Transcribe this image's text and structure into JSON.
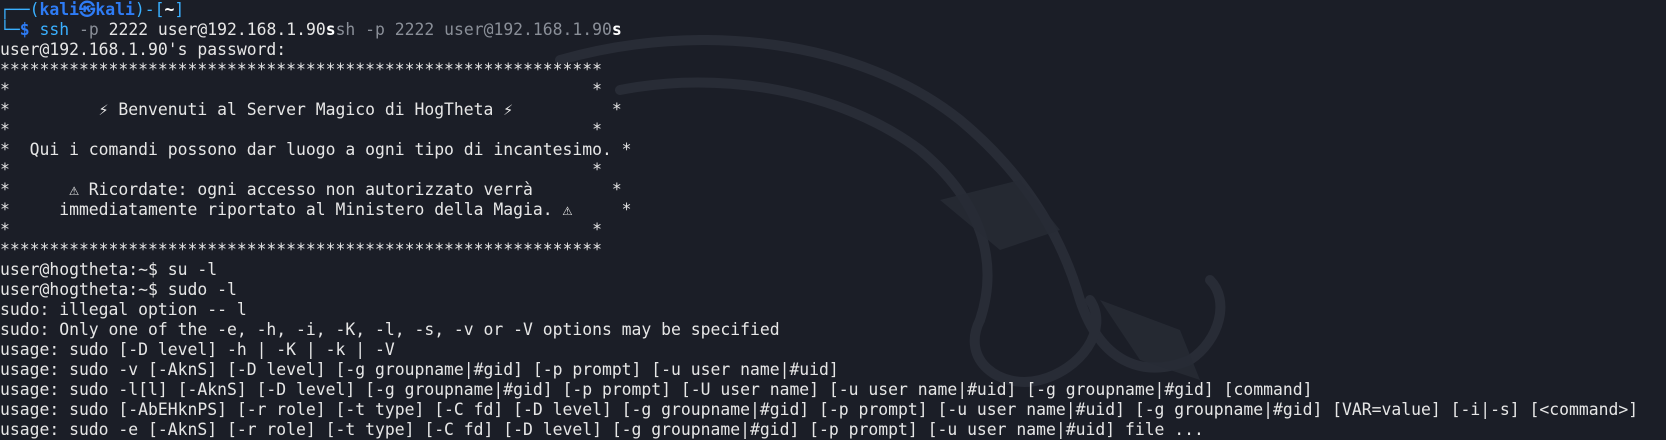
{
  "prompt": {
    "corner_top": "┌──(",
    "user": "kali",
    "at_symbol": "㉿",
    "host": "kali",
    "mid": ")-[",
    "dir": "~",
    "end": "]",
    "corner_bottom": "└─",
    "dollar": "$",
    "command": "ssh",
    "args_dim": " -p",
    "args_rest": " 2222 user@192.168.1.90",
    "cursor_char": "s",
    "autosuggest": "sh -p 2222 user@192.168.1.90",
    "autosuggest_end": "s"
  },
  "lines": [
    "user@192.168.1.90's password:",
    "*************************************************************",
    "*                                                           *",
    "*         ⚡ Benvenuti al Server Magico di HogTheta ⚡          *",
    "*                                                           *",
    "*  Qui i comandi possono dar luogo a ogni tipo di incantesimo. *",
    "*                                                           *",
    "*      ⚠ Ricordate: ogni accesso non autorizzato verrà        *",
    "*     immediatamente riportato al Ministero della Magia. ⚠     *",
    "*                                                           *",
    "*************************************************************",
    "user@hogtheta:~$ su -l",
    "user@hogtheta:~$ sudo -l",
    "sudo: illegal option -- l",
    "sudo: Only one of the -e, -h, -i, -K, -l, -s, -v or -V options may be specified",
    "usage: sudo [-D level] -h | -K | -k | -V",
    "usage: sudo -v [-AknS] [-D level] [-g groupname|#gid] [-p prompt] [-u user name|#uid]",
    "usage: sudo -l[l] [-AknS] [-D level] [-g groupname|#gid] [-p prompt] [-U user name] [-u user name|#uid] [-g groupname|#gid] [command]",
    "usage: sudo [-AbEHknPS] [-r role] [-t type] [-C fd] [-D level] [-g groupname|#gid] [-p prompt] [-u user name|#uid] [-g groupname|#gid] [VAR=value] [-i|-s] [<command>]",
    "usage: sudo -e [-AknS] [-r role] [-t type] [-C fd] [-D level] [-g groupname|#gid] [-p prompt] [-u user name|#uid] file ..."
  ],
  "colors": {
    "background": "#1b1e27",
    "prompt_blue": "#2e7cf6",
    "command_cyan": "#3ab0ff",
    "dim_gray": "#8a8f98",
    "text": "#e6e6e6"
  }
}
